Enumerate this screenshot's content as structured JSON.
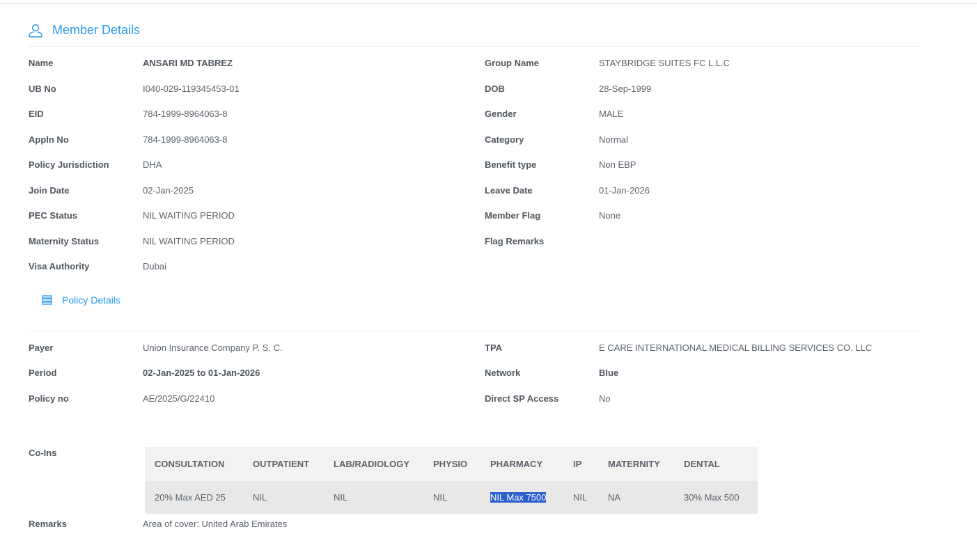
{
  "member": {
    "title": "Member Details",
    "left": [
      [
        "Name",
        "ANSARI MD TABREZ"
      ],
      [
        "UB No",
        "I040-029-119345453-01"
      ],
      [
        "EID",
        "784-1999-8964063-8"
      ],
      [
        "Appln No",
        "784-1999-8964063-8"
      ],
      [
        "Policy Jurisdiction",
        "DHA"
      ],
      [
        "Join Date",
        "02-Jan-2025"
      ],
      [
        "PEC Status",
        "NIL WAITING PERIOD"
      ],
      [
        "Maternity Status",
        "NIL WAITING PERIOD"
      ],
      [
        "Visa Authority",
        "Dubai"
      ]
    ],
    "right": [
      [
        "Group Name",
        "STAYBRIDGE SUITES FC L.L.C"
      ],
      [
        "DOB",
        "28-Sep-1999"
      ],
      [
        "Gender",
        "MALE"
      ],
      [
        "Category",
        "Normal"
      ],
      [
        "Benefit type",
        "Non EBP"
      ],
      [
        "Leave Date",
        "01-Jan-2026"
      ],
      [
        "Member Flag",
        "None"
      ],
      [
        "Flag Remarks",
        ""
      ]
    ]
  },
  "policy": {
    "title": "Policy Details",
    "left": [
      [
        "Payer",
        "Union Insurance Company P. S. C."
      ],
      [
        "Period",
        "02-Jan-2025 to 01-Jan-2026"
      ],
      [
        "Policy no",
        "AE/2025/G/22410"
      ]
    ],
    "right": [
      [
        "TPA",
        "E CARE INTERNATIONAL MEDICAL BILLING SERVICES CO. LLC"
      ],
      [
        "Network",
        "Blue"
      ],
      [
        "Direct SP Access",
        "No"
      ]
    ]
  },
  "coins": {
    "label": "Co-Ins",
    "headers": [
      "CONSULTATION",
      "OUTPATIENT",
      "LAB/RADIOLOGY",
      "PHYSIO",
      "PHARMACY",
      "IP",
      "MATERNITY",
      "DENTAL"
    ],
    "values": [
      "20% Max AED 25",
      "NIL",
      "NIL",
      "NIL",
      "NIL Max 7500",
      "NIL",
      "NA",
      "30% Max 500"
    ]
  },
  "remarks": {
    "label": "Remarks",
    "value": "Area of cover: United Arab Emirates"
  }
}
